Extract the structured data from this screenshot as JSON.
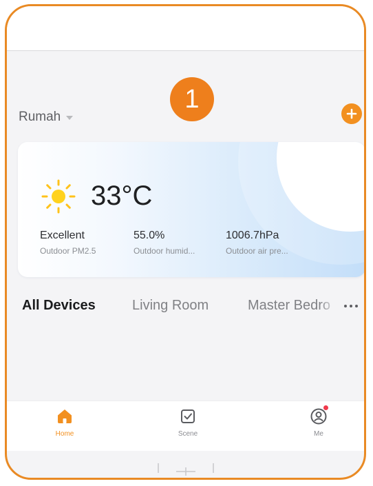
{
  "step_badge": "1",
  "header": {
    "home_name": "Rumah"
  },
  "weather": {
    "temperature": "33°C",
    "stats": [
      {
        "value": "Excellent",
        "label": "Outdoor PM2.5"
      },
      {
        "value": "55.0%",
        "label": "Outdoor humid..."
      },
      {
        "value": "1006.7hPa",
        "label": "Outdoor air pre..."
      }
    ]
  },
  "tabs": [
    {
      "label": "All Devices",
      "active": true
    },
    {
      "label": "Living Room",
      "active": false
    },
    {
      "label": "Master Bedro",
      "active": false
    }
  ],
  "bottom_nav": [
    {
      "label": "Home",
      "icon": "home-icon",
      "active": true
    },
    {
      "label": "Scene",
      "icon": "scene-icon",
      "active": false
    },
    {
      "label": "Me",
      "icon": "profile-icon",
      "active": false,
      "notification": true
    }
  ],
  "colors": {
    "accent": "#f29020",
    "frame_border": "#e98a24",
    "badge": "#ee7f1c",
    "notification": "#f0394b"
  }
}
